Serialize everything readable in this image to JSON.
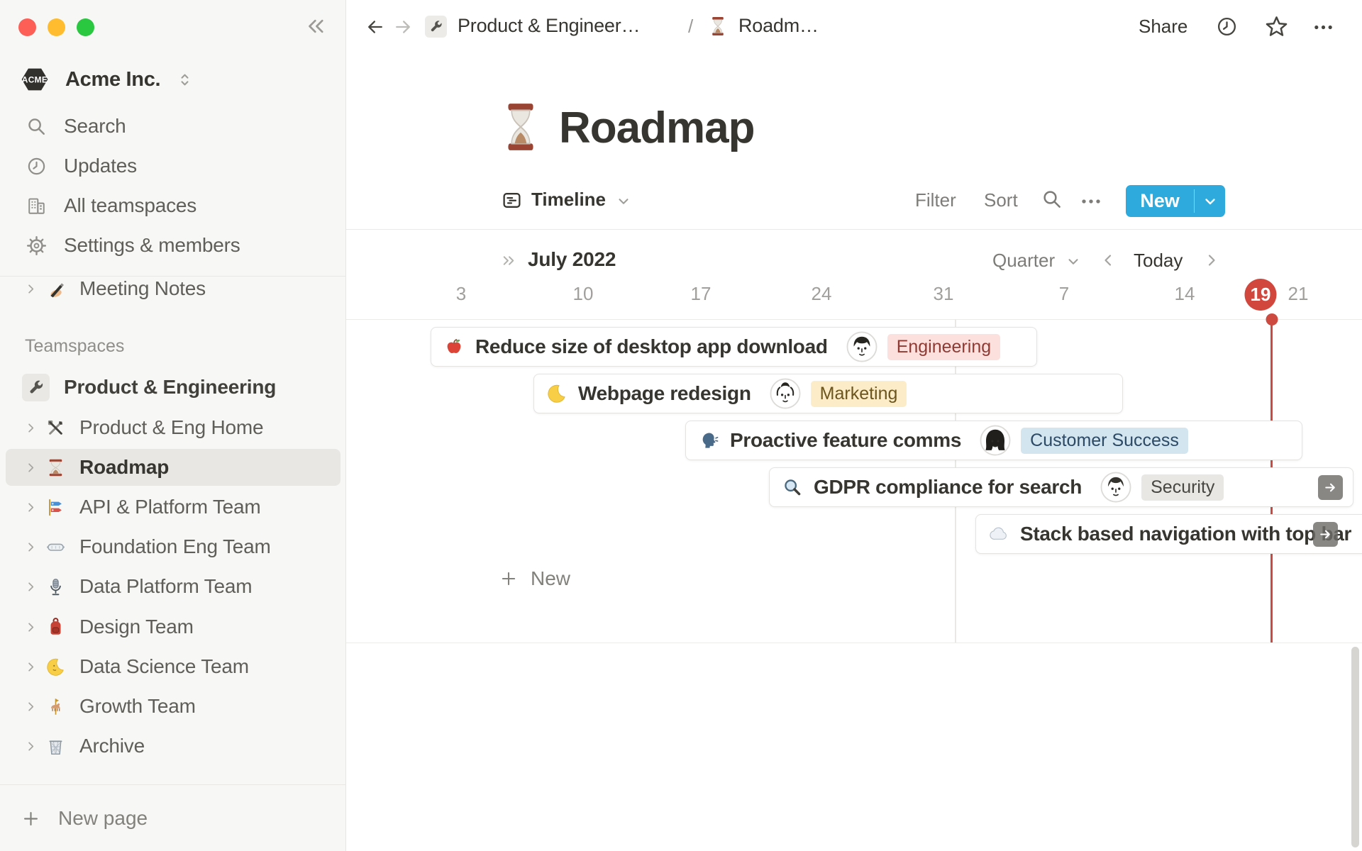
{
  "window": {
    "traffic_lights": [
      "close",
      "minimize",
      "zoom"
    ],
    "traffic_colors": [
      "#fd5f57",
      "#febc2e",
      "#29c840"
    ]
  },
  "sidebar": {
    "collapse_icon": "collapse-sidebar-icon",
    "expand_icon": "chevron-right-icon",
    "workspace": {
      "name": "Acme Inc.",
      "logo_text": "ACME",
      "logo_icon": "acme-logo",
      "switcher_icon": "updown-icon"
    },
    "menu": [
      {
        "icon": "search-icon",
        "label": "Search"
      },
      {
        "icon": "clock-icon",
        "label": "Updates"
      },
      {
        "icon": "building-icon",
        "label": "All teamspaces"
      },
      {
        "icon": "gear-icon",
        "label": "Settings & members"
      }
    ],
    "pages": [
      {
        "icon": "writing-hand-emoji",
        "label": "Meeting Notes"
      }
    ],
    "teamspaces_label": "Teamspaces",
    "teamspaces": [
      {
        "icon": "wrench-emoji",
        "label": "Product & Engineering"
      },
      {
        "icon": "hammer-wrench-emoji",
        "label": "Product & Eng Home"
      },
      {
        "icon": "hourglass-emoji",
        "label": "Roadmap",
        "selected": true
      },
      {
        "icon": "carp-streamer-emoji",
        "label": "API & Platform Team"
      },
      {
        "icon": "goggles-emoji",
        "label": "Foundation Eng Team"
      },
      {
        "icon": "microphone-emoji",
        "label": "Data Platform Team"
      },
      {
        "icon": "backpack-emoji",
        "label": "Design Team"
      },
      {
        "icon": "moon-face-emoji",
        "label": "Data Science Team"
      },
      {
        "icon": "carousel-horse-emoji",
        "label": "Growth Team"
      },
      {
        "icon": "wastebasket-emoji",
        "label": "Archive"
      }
    ],
    "new_page": {
      "icon": "plus-icon",
      "label": "New page"
    }
  },
  "topbar": {
    "back_icon": "arrow-left-icon",
    "forward_icon": "arrow-right-icon",
    "breadcrumb": [
      {
        "icon": "wrench-emoji",
        "label": "Product & Engineer…"
      },
      {
        "icon": "hourglass-emoji",
        "label": "Roadm…"
      }
    ],
    "breadcrumb_separator": "/",
    "share_label": "Share",
    "history_icon": "clock-icon",
    "favorite_icon": "star-icon",
    "more_icon": "dots-icon"
  },
  "page": {
    "title": "Roadmap",
    "title_icon": "hourglass-emoji"
  },
  "view_controls": {
    "view_icon": "timeline-view-icon",
    "view_name": "Timeline",
    "view_dropdown_icon": "chevron-down-icon",
    "filter_label": "Filter",
    "sort_label": "Sort",
    "search_icon": "search-icon",
    "more_icon": "dots-icon",
    "new_button": {
      "label": "New",
      "color": "#2eaadc",
      "dropdown_icon": "chevron-down-white-icon"
    }
  },
  "timeline": {
    "expand_icon": "double-chevron-right-icon",
    "month_label": "July 2022",
    "zoom_level": "Quarter",
    "zoom_dropdown_icon": "chevron-down-icon",
    "prev_icon": "chevron-left-icon",
    "today_label": "Today",
    "next_icon": "chevron-right-icon",
    "dates": [
      "3",
      "10",
      "17",
      "24",
      "31",
      "7",
      "14",
      "19",
      "21"
    ],
    "today_date": "19",
    "today_color": "#d2473d",
    "items": [
      {
        "emoji": "apple-emoji",
        "title": "Reduce size of desktop app download",
        "avatar": "avatar-man-1",
        "tag": "Engineering",
        "tag_bg": "#fbe0de",
        "tag_color": "#8f3a33"
      },
      {
        "emoji": "crescent-moon-emoji",
        "title": "Webpage redesign",
        "avatar": "avatar-man-2",
        "tag": "Marketing",
        "tag_bg": "#fdecc8",
        "tag_color": "#6c561e"
      },
      {
        "emoji": "speaking-head-emoji",
        "title": "Proactive feature comms",
        "avatar": "avatar-woman",
        "tag": "Customer Success",
        "tag_bg": "#d3e5ef",
        "tag_color": "#2c4a66"
      },
      {
        "emoji": "magnifier-emoji",
        "title": "GDPR compliance for search",
        "avatar": "avatar-man-3",
        "tag": "Security",
        "tag_bg": "#e8e7e4",
        "tag_color": "#474640",
        "open_icon": "open-arrow-icon"
      },
      {
        "emoji": "cloud-emoji",
        "title": "Stack based navigation with top bar",
        "open_icon": "open-arrow-icon"
      }
    ],
    "new_row_label": "New",
    "new_row_icon": "plus-icon"
  }
}
